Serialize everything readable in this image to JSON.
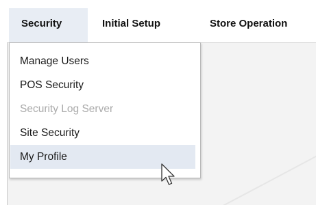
{
  "menubar": {
    "items": [
      {
        "label": "Security"
      },
      {
        "label": "Initial Setup"
      },
      {
        "label": "Store Operation"
      }
    ]
  },
  "dropdown": {
    "items": [
      {
        "label": "Manage Users",
        "enabled": true
      },
      {
        "label": "POS Security",
        "enabled": true
      },
      {
        "label": "Security Log Server",
        "enabled": false
      },
      {
        "label": "Site Security",
        "enabled": true
      },
      {
        "label": "My Profile",
        "enabled": true,
        "hovered": true
      }
    ]
  },
  "colors": {
    "active_menu_bg": "#e8edf4",
    "hover_item_bg": "#e3e9f2",
    "disabled_text": "#aaaaaa"
  },
  "icons": {
    "cursor": "mouse-pointer-icon"
  }
}
